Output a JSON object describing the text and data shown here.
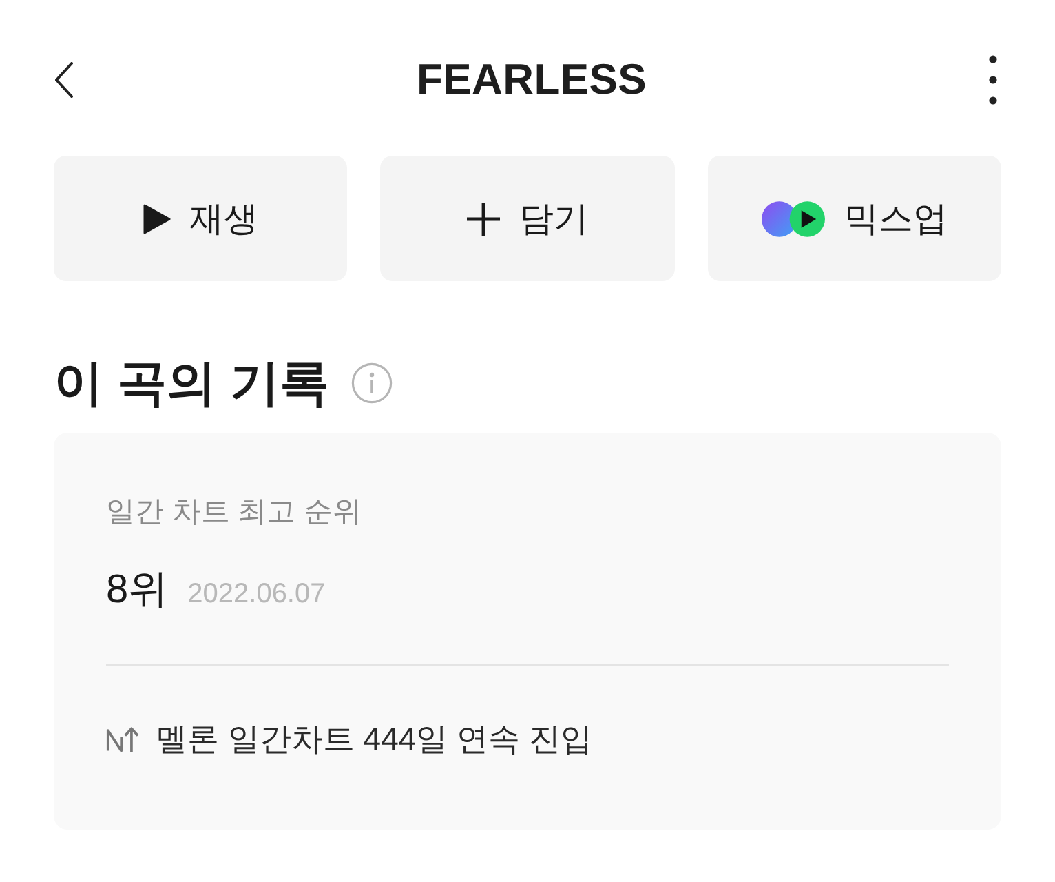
{
  "header": {
    "title": "FEARLESS"
  },
  "actions": [
    {
      "kind": "play",
      "label": "재생"
    },
    {
      "kind": "add",
      "label": "담기"
    },
    {
      "kind": "mixup",
      "label": "믹스업"
    }
  ],
  "record": {
    "title": "이 곡의 기록",
    "peak": {
      "label": "일간 차트 최고 순위",
      "rank": "8위",
      "date": "2022.06.07"
    },
    "streak": {
      "text": "멜론 일간차트 444일 연속 진입"
    }
  }
}
